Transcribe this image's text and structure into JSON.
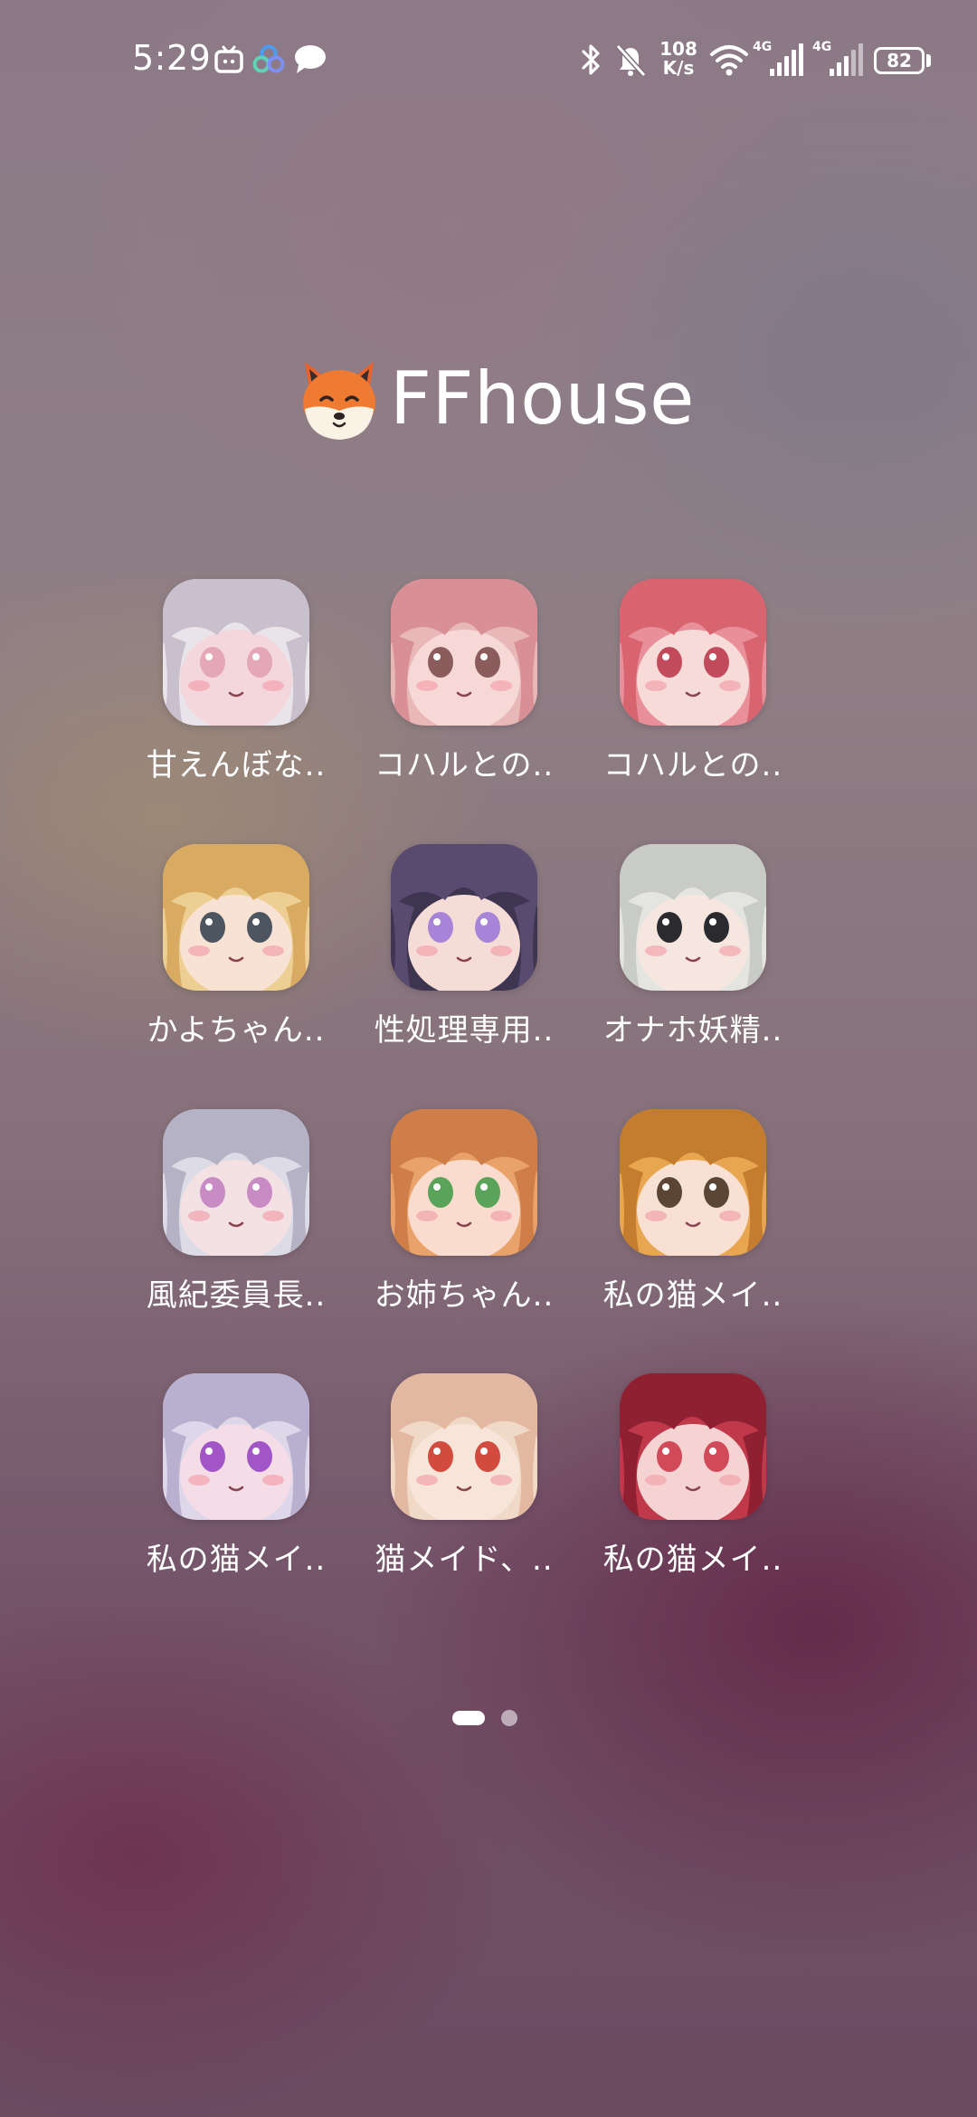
{
  "status_bar": {
    "time": "5:29",
    "notification_icons": [
      "tv-icon",
      "cloud-icon",
      "message-icon"
    ],
    "network_speed_value": "108",
    "network_speed_unit": "K/s",
    "signal1_label": "4G",
    "signal2_label": "4G",
    "battery": "82"
  },
  "folder": {
    "emoji": "🦊",
    "title": "FFhouse"
  },
  "apps": [
    {
      "label": "甘えんぼな..",
      "palette": [
        "#e9e3ea",
        "#c8c0cc",
        "#f3d7dd",
        "#e4a7b8"
      ]
    },
    {
      "label": "コハルとの..",
      "palette": [
        "#e8b8b8",
        "#d88f96",
        "#f6d9d6",
        "#8b5c5c"
      ]
    },
    {
      "label": "コハルとの..",
      "palette": [
        "#e98f9a",
        "#d7646f",
        "#f7dbd8",
        "#c14b5a"
      ]
    },
    {
      "label": "かよちゃん..",
      "palette": [
        "#edcf94",
        "#d9ab62",
        "#f8e2d4",
        "#4d5560"
      ]
    },
    {
      "label": "性処理専用..",
      "palette": [
        "#3e3550",
        "#594a70",
        "#f5dcd6",
        "#a884d8"
      ]
    },
    {
      "label": "オナホ妖精..",
      "palette": [
        "#e4e4e0",
        "#c9cbc7",
        "#f5e6df",
        "#2b2b2f"
      ]
    },
    {
      "label": "風紀委員長..",
      "palette": [
        "#dcdbe6",
        "#b4b2c4",
        "#f3e1e4",
        "#c98bc4"
      ]
    },
    {
      "label": "お姉ちゃん..",
      "palette": [
        "#e9a26a",
        "#cf7e48",
        "#f9dccd",
        "#59a35a"
      ]
    },
    {
      "label": "私の猫メイ..",
      "palette": [
        "#e8a650",
        "#c47d2e",
        "#f8e0d2",
        "#5b4535"
      ]
    },
    {
      "label": "私の猫メイ..",
      "palette": [
        "#ded7ea",
        "#b9b0cf",
        "#f4dde6",
        "#a255c7"
      ]
    },
    {
      "label": "猫メイド、..",
      "palette": [
        "#f1d9c8",
        "#e3b8a0",
        "#f6e5d8",
        "#d24b3e"
      ]
    },
    {
      "label": "私の猫メイ..",
      "palette": [
        "#c0394a",
        "#8f2032",
        "#f4d3d2",
        "#d14a5a"
      ]
    }
  ],
  "page_indicator": {
    "pages": 2,
    "current": 1
  }
}
